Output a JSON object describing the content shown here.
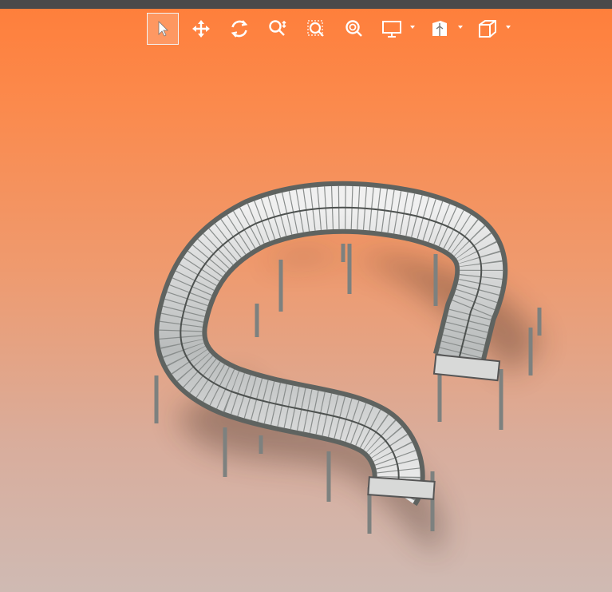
{
  "window": {
    "title_bar_color": "#4a4a4a"
  },
  "viewport": {
    "background_top": "#ff7e3a",
    "background_bottom": "#cfbab3"
  },
  "toolbar": {
    "tools": [
      {
        "name": "select",
        "icon": "cursor-arrow-icon",
        "selected": true
      },
      {
        "name": "pan",
        "icon": "move-arrows-icon",
        "selected": false
      },
      {
        "name": "rotate",
        "icon": "rotate-icon",
        "selected": false
      },
      {
        "name": "zoom",
        "icon": "zoom-icon",
        "selected": false
      },
      {
        "name": "zoom-to-area",
        "icon": "zoom-area-icon",
        "selected": false
      },
      {
        "name": "zoom-to-fit",
        "icon": "zoom-fit-icon",
        "selected": false
      },
      {
        "name": "display-style",
        "icon": "monitor-icon",
        "selected": false,
        "has_dropdown": true
      },
      {
        "name": "section-view",
        "icon": "section-icon",
        "selected": false,
        "has_dropdown": true
      },
      {
        "name": "view-orientation",
        "icon": "cube-icon",
        "selected": false,
        "has_dropdown": true
      }
    ]
  },
  "model": {
    "name": "roller-conveyor",
    "rail_color": "#5f6360",
    "roller_color": "#c9cbcb",
    "leg_color": "#8c908e"
  }
}
